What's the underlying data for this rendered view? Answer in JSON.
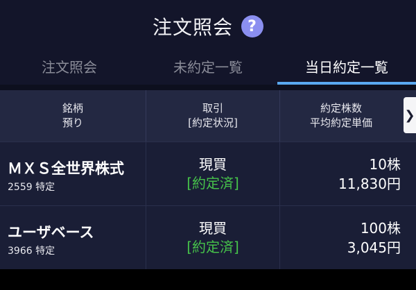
{
  "header": {
    "title": "注文照会",
    "help_icon": "question-circle-icon",
    "help_label": "?"
  },
  "tabs": [
    {
      "label": "注文照会",
      "active": false
    },
    {
      "label": "未約定一覧",
      "active": false
    },
    {
      "label": "当日約定一覧",
      "active": true
    }
  ],
  "table": {
    "columns": [
      {
        "line1": "銘柄",
        "line2": "預り"
      },
      {
        "line1": "取引",
        "line2": "[約定状況]"
      },
      {
        "line1": "約定株数",
        "line2": "平均約定単価"
      }
    ],
    "scroll_label": "❯",
    "rows": [
      {
        "name": "ＭＸＳ全世界株式",
        "code": "2559 特定",
        "trade": "現買",
        "status": "[約定済]",
        "qty": "10株",
        "price": "11,830円"
      },
      {
        "name": "ユーザベース",
        "code": "3966 特定",
        "trade": "現買",
        "status": "[約定済]",
        "qty": "100株",
        "price": "3,045円"
      }
    ]
  },
  "colors": {
    "background": "#13152a",
    "tab_indicator": "#5aa8f0",
    "status_green": "#46c24a",
    "help_purple": "#8b8ff0"
  }
}
